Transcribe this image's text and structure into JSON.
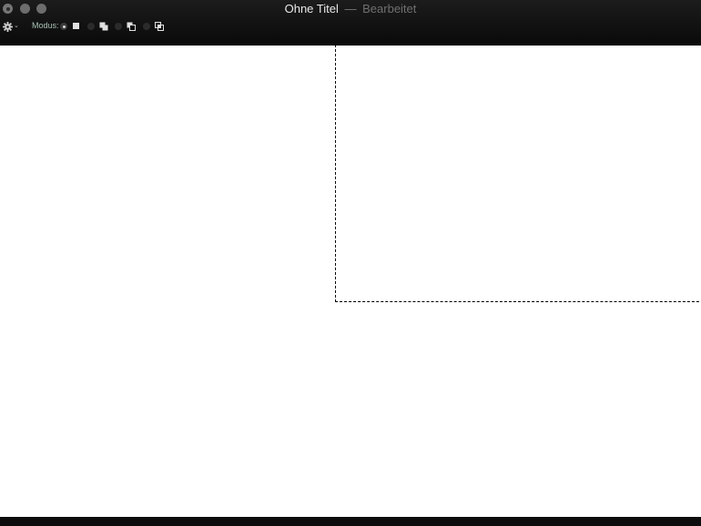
{
  "window": {
    "title": "Ohne Titel",
    "separator": "—",
    "status": "Bearbeitet"
  },
  "toolbar": {
    "mode_label": "Modus:",
    "modes": [
      {
        "name": "new-selection",
        "icon": "square-icon",
        "selected": true
      },
      {
        "name": "add-to-selection",
        "icon": "union-squares-icon",
        "selected": false
      },
      {
        "name": "subtract-from-selection",
        "icon": "subtract-squares-icon",
        "selected": false
      },
      {
        "name": "intersect-selection",
        "icon": "intersect-squares-icon",
        "selected": false
      }
    ]
  },
  "colors": {
    "titlebar": "#0a0a0a",
    "title_text": "#e8e8e8",
    "status_text": "#6f6f6f",
    "mode_label": "#a9c4b5",
    "canvas": "#ffffff"
  }
}
